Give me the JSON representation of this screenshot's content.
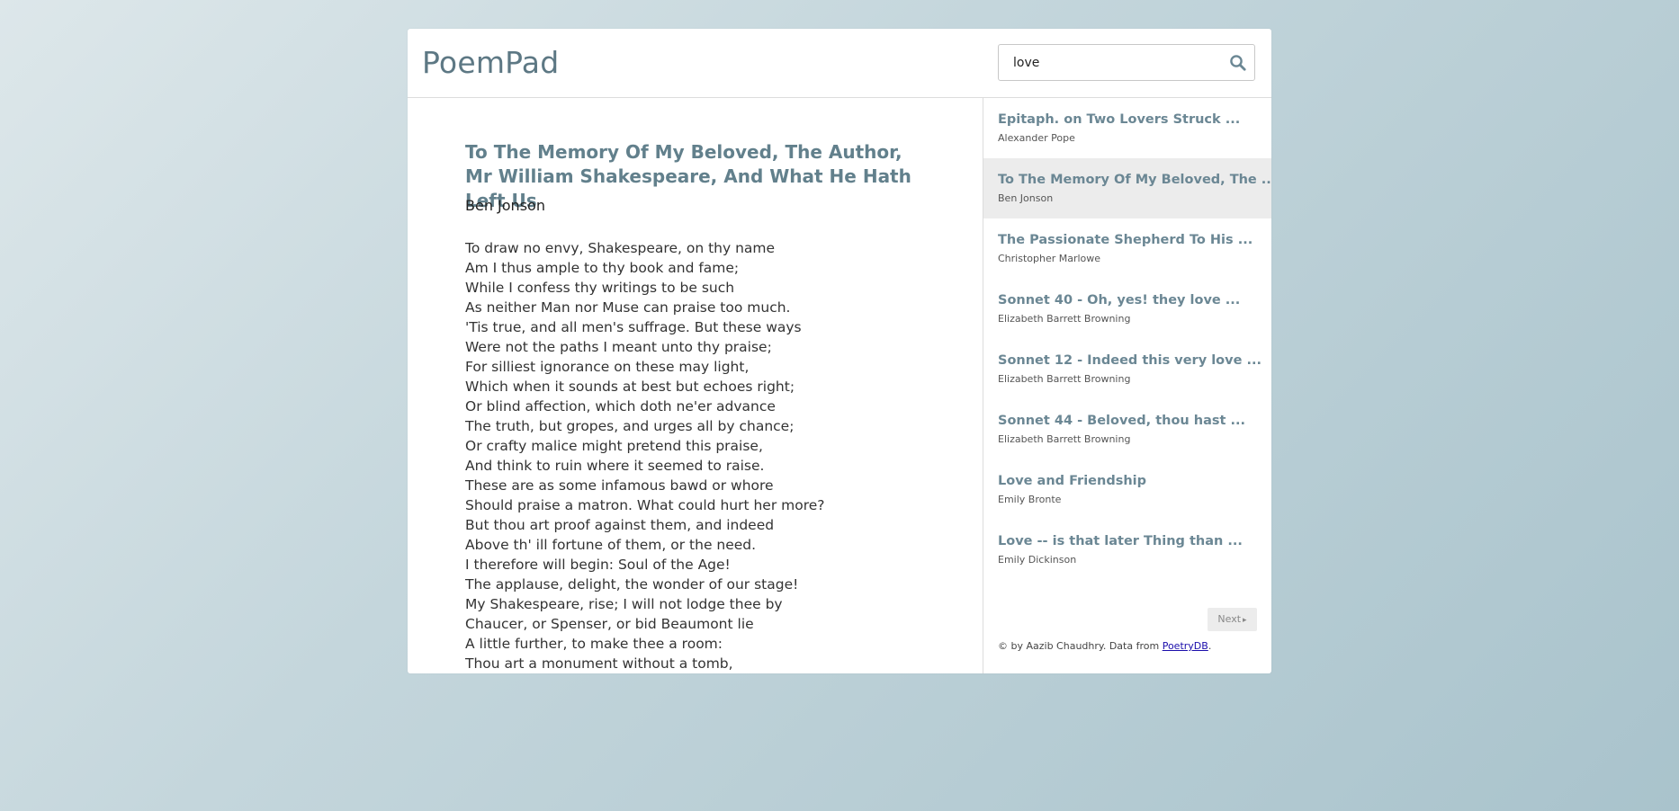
{
  "app": {
    "title": "PoemPad"
  },
  "search": {
    "value": "love",
    "icon": "search-icon"
  },
  "poem": {
    "title": "To The Memory Of My Beloved, The Author, Mr William Shakespeare, And What He Hath Left Us",
    "author": "Ben Jonson",
    "lines": [
      "To draw no envy, Shakespeare, on thy name",
      "Am I thus ample to thy book and fame;",
      "While I confess thy writings to be such",
      "As neither Man nor Muse can praise too much.",
      "'Tis true, and all men's suffrage. But these ways",
      "Were not the paths I meant unto thy praise;",
      "For silliest ignorance on these may light,",
      "Which when it sounds at best but echoes right;",
      "Or blind affection, which doth ne'er advance",
      "The truth, but gropes, and urges all by chance;",
      "Or crafty malice might pretend this praise,",
      "And think to ruin where it seemed to raise.",
      "These are as some infamous bawd or whore",
      "Should praise a matron. What could hurt her more?",
      "But thou art proof against them, and indeed",
      "Above th' ill fortune of them, or the need.",
      "I therefore will begin: Soul of the Age!",
      "The applause, delight, the wonder of our stage!",
      "My Shakespeare, rise; I will not lodge thee by",
      "Chaucer, or Spenser, or bid Beaumont lie",
      "A little further, to make thee a room:",
      "Thou art a monument without a tomb,"
    ]
  },
  "results": [
    {
      "title": "Epitaph. on Two Lovers Struck ...",
      "author": "Alexander Pope"
    },
    {
      "title": "To The Memory Of My Beloved, The ...",
      "author": "Ben Jonson",
      "active": true
    },
    {
      "title": "The Passionate Shepherd To His ...",
      "author": "Christopher Marlowe"
    },
    {
      "title": "Sonnet 40 - Oh, yes! they love ...",
      "author": "Elizabeth Barrett Browning"
    },
    {
      "title": "Sonnet 12 - Indeed this very love ...",
      "author": "Elizabeth Barrett Browning"
    },
    {
      "title": "Sonnet 44 - Beloved, thou hast ...",
      "author": "Elizabeth Barrett Browning"
    },
    {
      "title": "Love and Friendship",
      "author": "Emily Bronte"
    },
    {
      "title": "Love -- is that later Thing than ...",
      "author": "Emily Dickinson"
    }
  ],
  "pagination": {
    "next_label": "Next",
    "next_icon": "caret-right-icon"
  },
  "footer": {
    "text_before": "© by Aazib Chaudhry. Data from ",
    "link_label": "PoetryDB",
    "text_after": "."
  },
  "colors": {
    "brand": "#5d7884",
    "result_title": "#6b8794",
    "active_row": "#ececec",
    "link": "#1a0dab"
  }
}
